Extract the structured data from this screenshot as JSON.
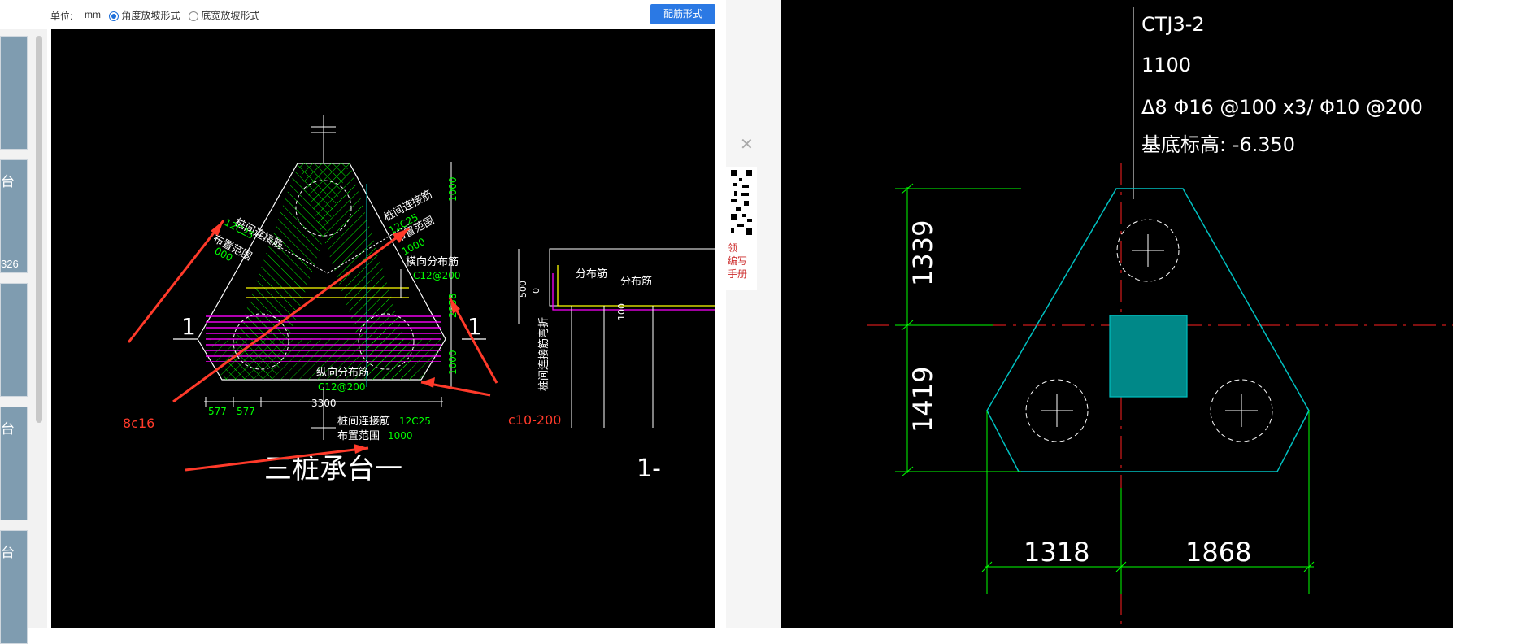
{
  "toolbar": {
    "unit_label": "单位:",
    "unit_value": "mm",
    "radio_angle": "角度放坡形式",
    "radio_width": "底宽放坡形式",
    "rebar_button": "配筋形式"
  },
  "thumbnails": {
    "t2": "台",
    "t2_num": "326",
    "t4": "台",
    "t5": "台"
  },
  "left_drawing": {
    "label_pile_conn_left": "桩间连接筋",
    "label_12c25_left": "12C25",
    "label_range_left": "布置范围",
    "label_1000_left": "000",
    "label_pile_conn_right": "桩间连接筋",
    "label_12c25_right": "12C25",
    "label_range_right": "布置范围",
    "label_1000_right": "1000",
    "label_horiz_dist": "横向分布筋",
    "label_c12_200_top": "C12@200",
    "label_long_dist": "纵向分布筋",
    "label_c12_200_bottom": "C12@200",
    "label_bottom_conn": "桩间连接筋",
    "label_bottom_12c25": "12C25",
    "label_bottom_range": "布置范围",
    "label_bottom_1000": "1000",
    "title": "三桩承台一",
    "section_mark": "1",
    "dim_577a": "577",
    "dim_577b": "577",
    "dim_3300": "3300",
    "dim_1000_top": "1000",
    "dim_2858": "2858",
    "dim_1000_bottom": "1000",
    "annot_8c16": "8c16",
    "annot_c10_200": "c10-200",
    "section_dist_1": "分布筋",
    "section_dist_2": "分布筋",
    "section_500": "500",
    "section_0": "0",
    "section_100": "100",
    "section_vertical_label": "桩间连接筋弯折",
    "section_mark_right": "1-"
  },
  "qr_side": {
    "line1": "领",
    "line2": "编写",
    "line3": "手册"
  },
  "right_drawing": {
    "name": "CTJ3-2",
    "height": "1100",
    "rebar": "Δ8 Φ16 @100 x3/ Φ10 @200",
    "base_elevation": "基底标高: -6.350",
    "dim_1339": "1339",
    "dim_1419": "1419",
    "dim_1318": "1318",
    "dim_1868": "1868"
  },
  "colors": {
    "accent": "#2b79e4",
    "cad_green": "#00ff00",
    "cad_cyan": "#00c0c0",
    "cad_red": "#ff2020",
    "annot_red": "#ff3a2a",
    "magenta": "#ff00ff",
    "yellow": "#ffff00"
  }
}
